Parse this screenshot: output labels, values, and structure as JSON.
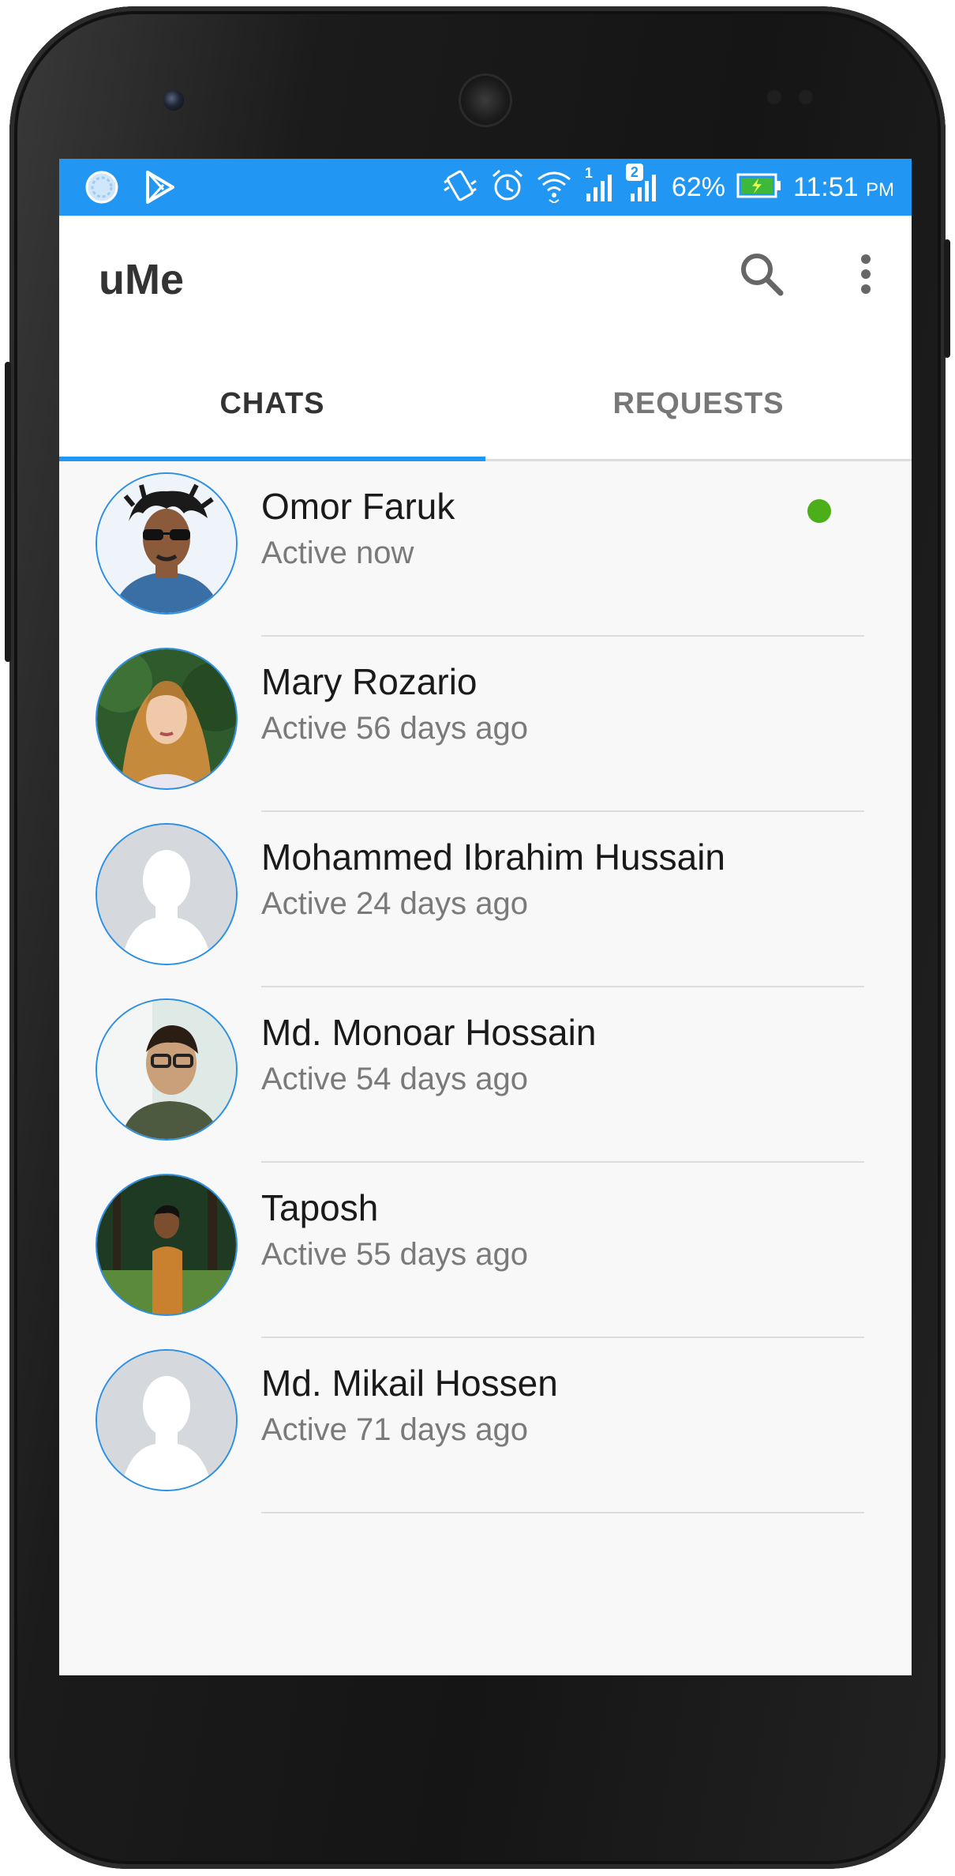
{
  "statusbar": {
    "battery_percent": "62%",
    "time": "11:51",
    "ampm": "PM",
    "sim1_label": "1",
    "sim2_label": "2",
    "icons": [
      "loading-icon",
      "play-store-icon",
      "vibrate-icon",
      "alarm-icon",
      "wifi-icon",
      "signal-sim1-icon",
      "signal-sim2-icon",
      "battery-charging-icon"
    ]
  },
  "appbar": {
    "title": "uMe",
    "search_icon": "search-icon",
    "menu_icon": "more-vert-icon"
  },
  "tabs": [
    {
      "label": "CHATS",
      "active": true
    },
    {
      "label": "REQUESTS",
      "active": false
    }
  ],
  "chats": [
    {
      "name": "Omor Faruk",
      "status": "Active now",
      "online": true,
      "avatar": "photo"
    },
    {
      "name": "Mary Rozario",
      "status": "Active 56 days ago",
      "online": false,
      "avatar": "photo"
    },
    {
      "name": "Mohammed Ibrahim Hussain",
      "status": "Active 24 days ago",
      "online": false,
      "avatar": "placeholder"
    },
    {
      "name": "Md. Monoar Hossain",
      "status": "Active 54 days ago",
      "online": false,
      "avatar": "photo"
    },
    {
      "name": "Taposh",
      "status": "Active 55 days ago",
      "online": false,
      "avatar": "photo"
    },
    {
      "name": "Md. Mikail Hossen",
      "status": "Active 71 days ago",
      "online": false,
      "avatar": "placeholder"
    }
  ],
  "colors": {
    "accent": "#2196f3",
    "online": "#4caf1a",
    "avatar_border": "#2b8fe6"
  }
}
